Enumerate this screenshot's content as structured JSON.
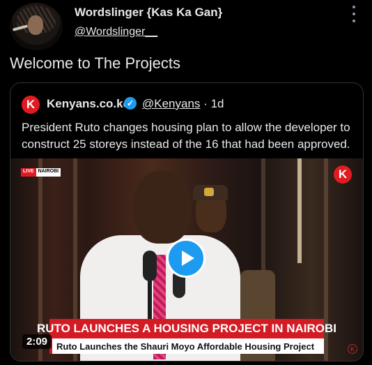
{
  "author": {
    "display_name": "Wordslinger {Kas Ka Gan}",
    "handle": "@Wordslinger__"
  },
  "tweet": {
    "text": "Welcome to The Projects"
  },
  "quoted": {
    "logo_letter": "K",
    "name": "Kenyans.co.ke",
    "handle": "@Kenyans",
    "separator": "·",
    "time": "1d",
    "verified_icon": "verified-check-icon",
    "text": "President Ruto changes housing plan to allow the developer to construct 25 storeys instead of the 16 that had been approved."
  },
  "video": {
    "live_label": "LIVE",
    "location_label": "NAIROBI",
    "channel_letter": "K",
    "headline": "RUTO LAUNCHES A HOUSING PROJECT IN NAIROBI",
    "subline": "Ruto Launches the Shauri Moyo Affordable Housing Project",
    "duration": "2:09",
    "corner_letter": "K",
    "play_icon": "play-icon"
  },
  "colors": {
    "accent": "#1d9bf0",
    "brand_red": "#e11b22",
    "background": "#000000"
  }
}
